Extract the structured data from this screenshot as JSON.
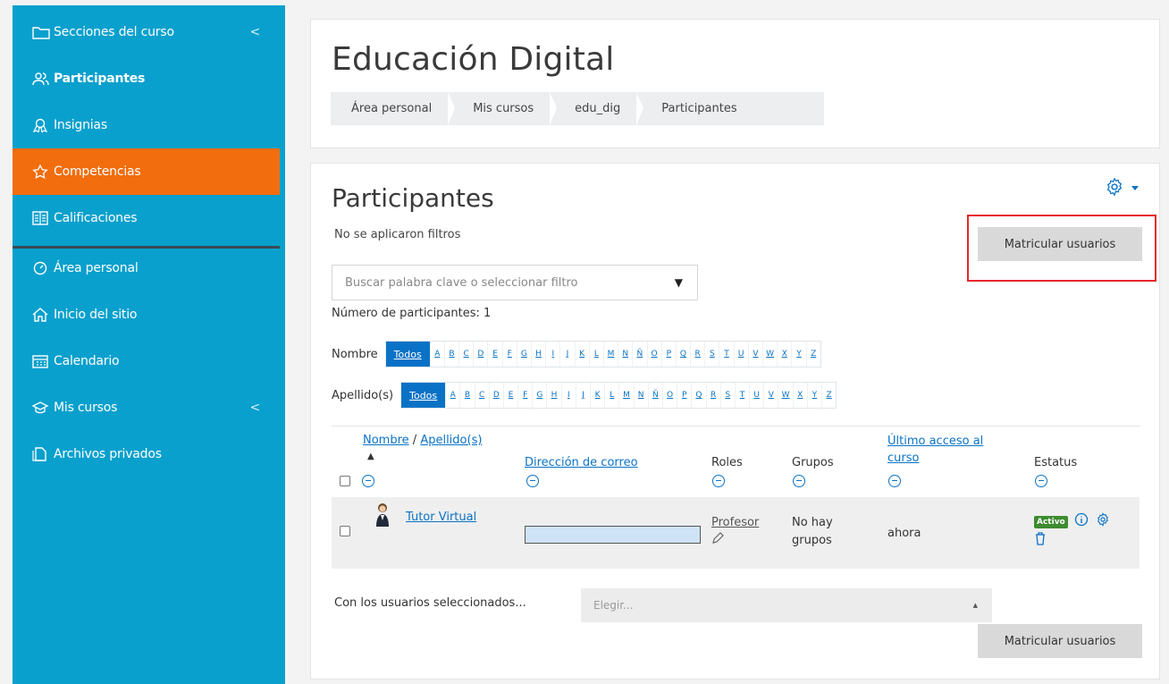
{
  "sidebar": {
    "items": [
      {
        "label": "Secciones del curso",
        "icon": "folder-icon",
        "chevron": "<"
      },
      {
        "label": "Participantes",
        "icon": "users-icon"
      },
      {
        "label": "Insignias",
        "icon": "badge-icon"
      },
      {
        "label": "Competencias",
        "icon": "star-icon"
      },
      {
        "label": "Calificaciones",
        "icon": "gradebook-icon"
      },
      {
        "label": "Área personal",
        "icon": "dashboard-icon"
      },
      {
        "label": "Inicio del sitio",
        "icon": "home-icon"
      },
      {
        "label": "Calendario",
        "icon": "calendar-icon"
      },
      {
        "label": "Mis cursos",
        "icon": "graduation-cap-icon",
        "chevron": "<"
      },
      {
        "label": "Archivos privados",
        "icon": "files-icon"
      }
    ]
  },
  "header": {
    "title": "Educación Digital",
    "breadcrumb": [
      "Área personal",
      "Mis cursos",
      "edu_dig",
      "Participantes"
    ]
  },
  "participants": {
    "title": "Participantes",
    "no_filters": "No se aplicaron filtros",
    "enrol_button": "Matricular usuarios",
    "search_placeholder": "Buscar palabra clave o seleccionar filtro",
    "count_text": "Número de participantes: 1",
    "initials_first_label": "Nombre",
    "initials_last_label": "Apellido(s)",
    "todos": "Todos",
    "letters": [
      "A",
      "B",
      "C",
      "D",
      "E",
      "F",
      "G",
      "H",
      "I",
      "J",
      "K",
      "L",
      "M",
      "N",
      "Ñ",
      "O",
      "P",
      "Q",
      "R",
      "S",
      "T",
      "U",
      "V",
      "W",
      "X",
      "Y",
      "Z"
    ],
    "table": {
      "col_name_first": "Nombre",
      "col_name_sep": " / ",
      "col_name_last": "Apellido(s)",
      "col_email": "Dirección de correo",
      "col_roles": "Roles",
      "col_groups": "Grupos",
      "col_last_access_1": "Último acceso al",
      "col_last_access_2": "curso",
      "col_status": "Estatus",
      "rows": [
        {
          "name": "Tutor Virtual",
          "role": "Profesor",
          "groups_1": "No hay",
          "groups_2": "grupos",
          "last_access": "ahora",
          "status": "Activo"
        }
      ]
    },
    "bulk_label": "Con los usuarios seleccionados...",
    "bulk_select": "Elegir..."
  }
}
